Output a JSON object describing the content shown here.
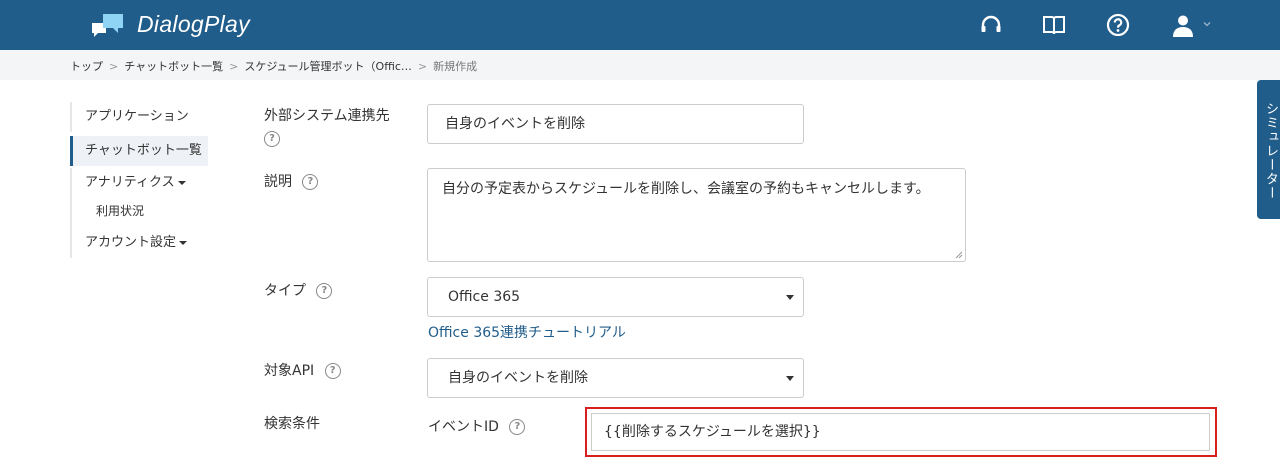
{
  "header": {
    "brand": "DialogPlay",
    "icons": [
      "headset-icon",
      "book-icon",
      "help-icon",
      "user-icon",
      "chevron-down-icon"
    ],
    "bg_color": "#215d8b"
  },
  "breadcrumb": {
    "items": [
      "トップ",
      "チャットボット一覧",
      "スケジュール管理ボット（Offic…"
    ],
    "current": "新規作成",
    "separator": ">"
  },
  "sidebar": {
    "items": [
      {
        "label": "アプリケーション"
      },
      {
        "label": "チャットボット一覧",
        "active": true
      },
      {
        "label": "アナリティクス"
      },
      {
        "label": "利用状況"
      },
      {
        "label": "アカウント設定"
      }
    ]
  },
  "form": {
    "external_system": {
      "label": "外部システム連携先",
      "value": "自身のイベントを削除"
    },
    "description": {
      "label": "説明",
      "value": "自分の予定表からスケジュールを削除し、会議室の予約もキャンセルします。"
    },
    "type": {
      "label": "タイプ",
      "value": "Office 365",
      "tutorial_link": "Office 365連携チュートリアル"
    },
    "target_api": {
      "label": "対象API",
      "value": "自身のイベントを削除"
    },
    "search_condition": {
      "label": "検索条件",
      "event_id_label": "イベントID",
      "event_id_value": "{{削除するスケジュールを選択}}"
    }
  },
  "simulator": {
    "label": "シミュレーター"
  },
  "colors": {
    "accent": "#215d8b",
    "highlight": "#d9201f"
  }
}
